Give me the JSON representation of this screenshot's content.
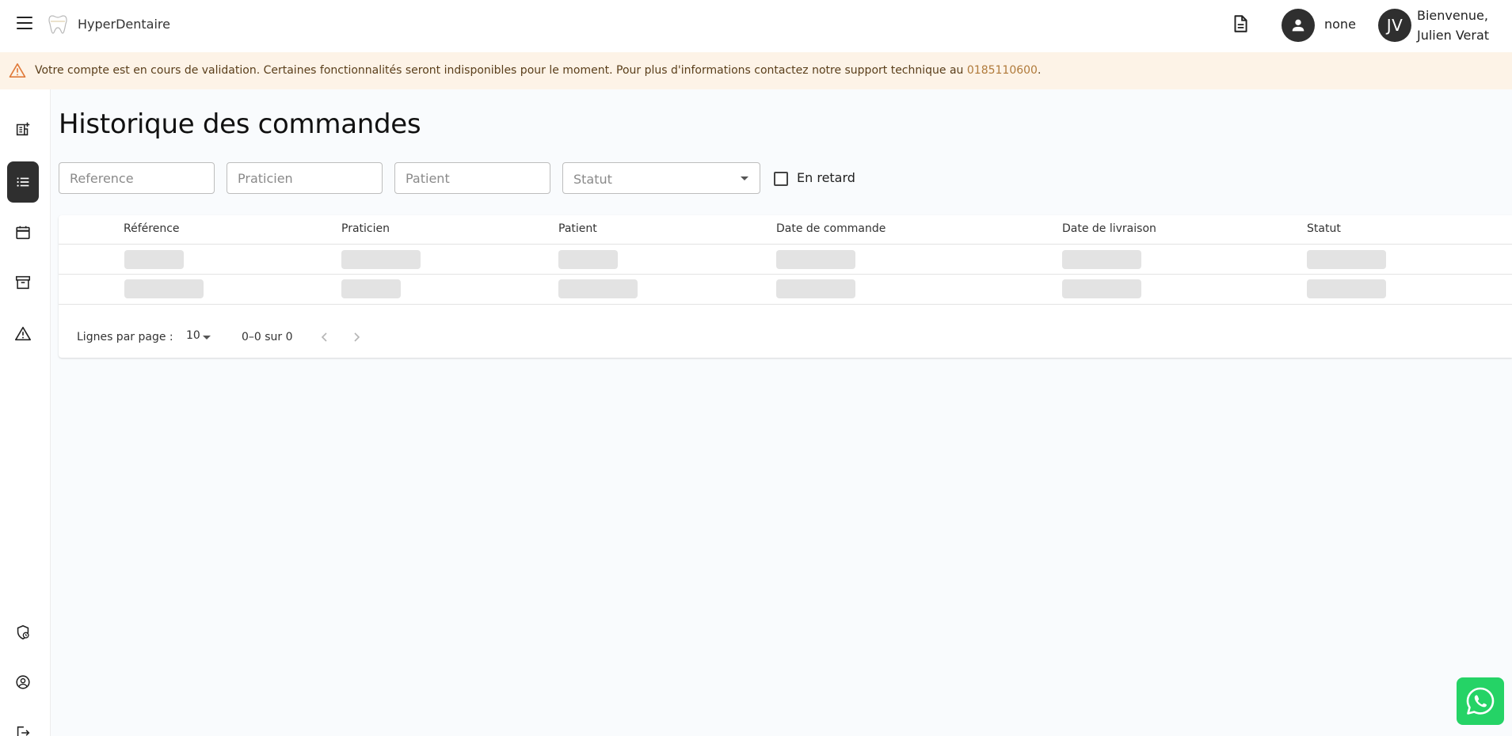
{
  "header": {
    "brand": "HyperDentaire",
    "user_label": "none",
    "avatar_initials": "JV",
    "welcome_line1": "Bienvenue,",
    "welcome_line2": "Julien Verat"
  },
  "banner": {
    "message": "Votre compte est en cours de validation. Certaines fonctionnalités seront indisponibles pour le moment. Pour plus d'informations contactez notre support technique au ",
    "phone": "0185110600",
    "suffix": ".",
    "accent_color": "#fdf3e7"
  },
  "sidebar": {
    "items": [
      {
        "icon": "new-order-icon",
        "active": false
      },
      {
        "icon": "list-icon",
        "active": true
      },
      {
        "icon": "calendar-icon",
        "active": false
      },
      {
        "icon": "archive-icon",
        "active": false
      },
      {
        "icon": "warning-icon",
        "active": false
      },
      {
        "icon": "shield-icon",
        "active": false
      },
      {
        "icon": "account-circle-icon",
        "active": false
      },
      {
        "icon": "logout-icon",
        "active": false
      }
    ]
  },
  "main": {
    "title": "Historique des commandes",
    "filters": {
      "reference_placeholder": "Reference",
      "praticien_placeholder": "Praticien",
      "patient_placeholder": "Patient",
      "statut_label": "Statut",
      "late_label": "En retard"
    },
    "table": {
      "columns": [
        "Référence",
        "Praticien",
        "Patient",
        "Date de commande",
        "Date de livraison",
        "Statut"
      ]
    },
    "pagination": {
      "rows_label": "Lignes par page :",
      "rows_value": "10",
      "range": "0–0 sur 0"
    }
  }
}
